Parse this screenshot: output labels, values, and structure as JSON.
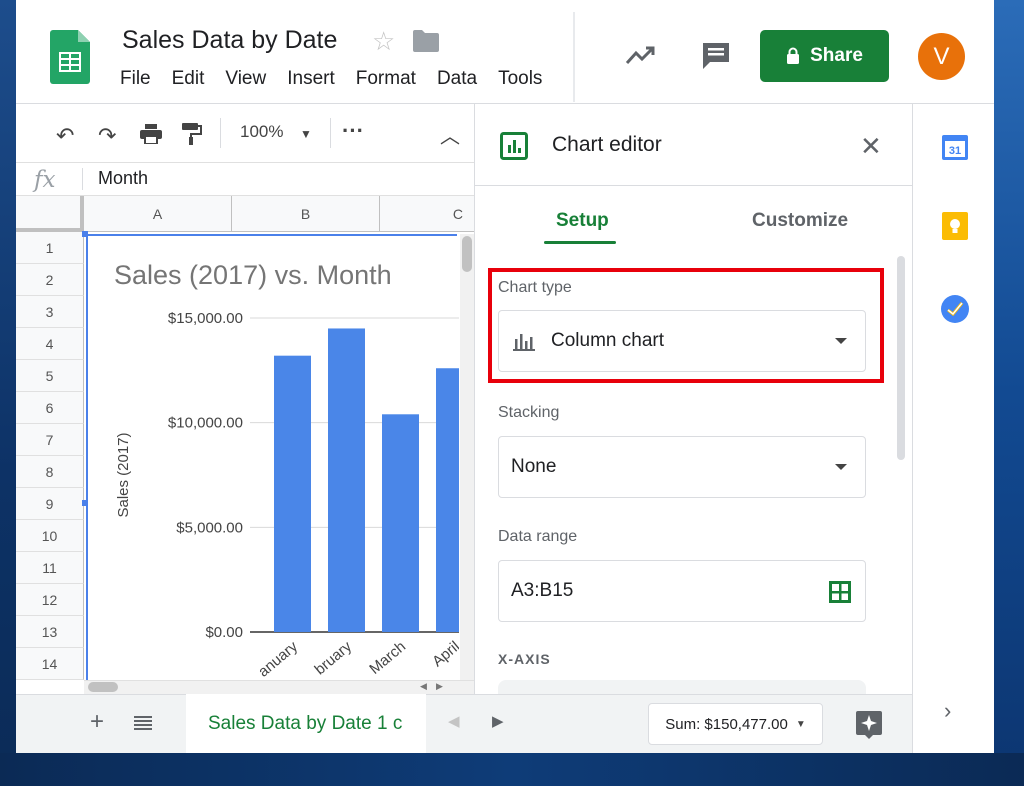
{
  "app": {
    "title": "Sales Data by Date",
    "menu": [
      "File",
      "Edit",
      "View",
      "Insert",
      "Format",
      "Data",
      "Tools"
    ],
    "share_label": "Share",
    "avatar_letter": "V",
    "accent_color": "#188038"
  },
  "toolbar": {
    "zoom": "100%",
    "icons": [
      "undo-icon",
      "redo-icon",
      "print-icon",
      "paint-format-icon",
      "more-icon",
      "collapse-icon"
    ]
  },
  "formula_bar": {
    "label": "fx",
    "value": "Month"
  },
  "grid": {
    "columns": [
      "A",
      "B",
      "C"
    ],
    "rows": [
      "1",
      "2",
      "3",
      "4",
      "5",
      "6",
      "7",
      "8",
      "9",
      "10",
      "11",
      "12",
      "13",
      "14"
    ]
  },
  "chart_data": {
    "type": "bar",
    "title": "Sales (2017) vs. Month",
    "xlabel": "",
    "ylabel": "Sales (2017)",
    "ylim": [
      0,
      15000
    ],
    "y_ticks": [
      "$15,000.00",
      "$10,000.00",
      "$5,000.00",
      "$0.00"
    ],
    "categories": [
      "January",
      "February",
      "March",
      "April"
    ],
    "category_labels_visible": [
      "anuary",
      "bruary",
      "March",
      "April"
    ],
    "values": [
      13200,
      14500,
      10400,
      12600
    ],
    "bar_color": "#4a86e8",
    "grid": true
  },
  "bottom": {
    "sheet_tab": "Sales Data by Date 1 c",
    "sum": "Sum: $150,477.00"
  },
  "editor": {
    "title": "Chart editor",
    "tabs": [
      "Setup",
      "Customize"
    ],
    "chart_type_label": "Chart type",
    "chart_type_value": "Column chart",
    "stacking_label": "Stacking",
    "stacking_value": "None",
    "data_range_label": "Data range",
    "data_range_value": "A3:B15",
    "x_axis_label": "X-AXIS",
    "highlight_color": "#e8000b"
  }
}
